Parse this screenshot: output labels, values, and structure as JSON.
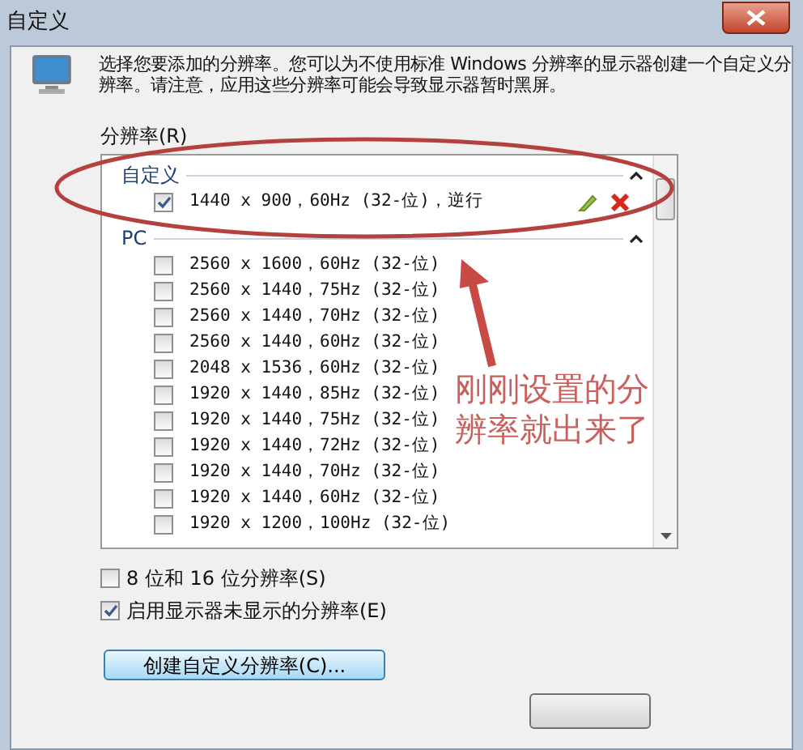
{
  "window": {
    "title": "自定义"
  },
  "description": "选择您要添加的分辨率。您可以为不使用标准 Windows 分辨率的显示器创建一个自定义分辨率。请注意，应用这些分辨率可能会导致显示器暂时黑屏。",
  "list_label": "分辨率(R)",
  "groups": [
    {
      "title": "自定义",
      "rows": [
        {
          "label": "1440 x 900，60Hz (32-位)，逆行",
          "checked": true,
          "kind": "custom"
        }
      ]
    },
    {
      "title": "PC",
      "rows": [
        {
          "label": "2560 x 1600，60Hz (32-位)",
          "checked": false,
          "kind": "standard"
        },
        {
          "label": "2560 x 1440，75Hz (32-位)",
          "checked": false,
          "kind": "standard"
        },
        {
          "label": "2560 x 1440，70Hz (32-位)",
          "checked": false,
          "kind": "standard"
        },
        {
          "label": "2560 x 1440，60Hz (32-位)",
          "checked": false,
          "kind": "standard"
        },
        {
          "label": "2048 x 1536，60Hz (32-位)",
          "checked": false,
          "kind": "standard"
        },
        {
          "label": "1920 x 1440，85Hz (32-位)",
          "checked": false,
          "kind": "standard"
        },
        {
          "label": "1920 x 1440，75Hz (32-位)",
          "checked": false,
          "kind": "standard"
        },
        {
          "label": "1920 x 1440，72Hz (32-位)",
          "checked": false,
          "kind": "standard"
        },
        {
          "label": "1920 x 1440，70Hz (32-位)",
          "checked": false,
          "kind": "standard"
        },
        {
          "label": "1920 x 1440，60Hz (32-位)",
          "checked": false,
          "kind": "standard"
        },
        {
          "label": "1920 x 1200，100Hz (32-位)",
          "checked": false,
          "kind": "standard"
        }
      ]
    }
  ],
  "options": [
    {
      "label": "8 位和 16 位分辨率(S)",
      "checked": false
    },
    {
      "label": "启用显示器未显示的分辨率(E)",
      "checked": true
    }
  ],
  "create_button": "创建自定义分辨率(C)...",
  "annotation": {
    "text": "刚刚设置的分辨率就出来了"
  }
}
